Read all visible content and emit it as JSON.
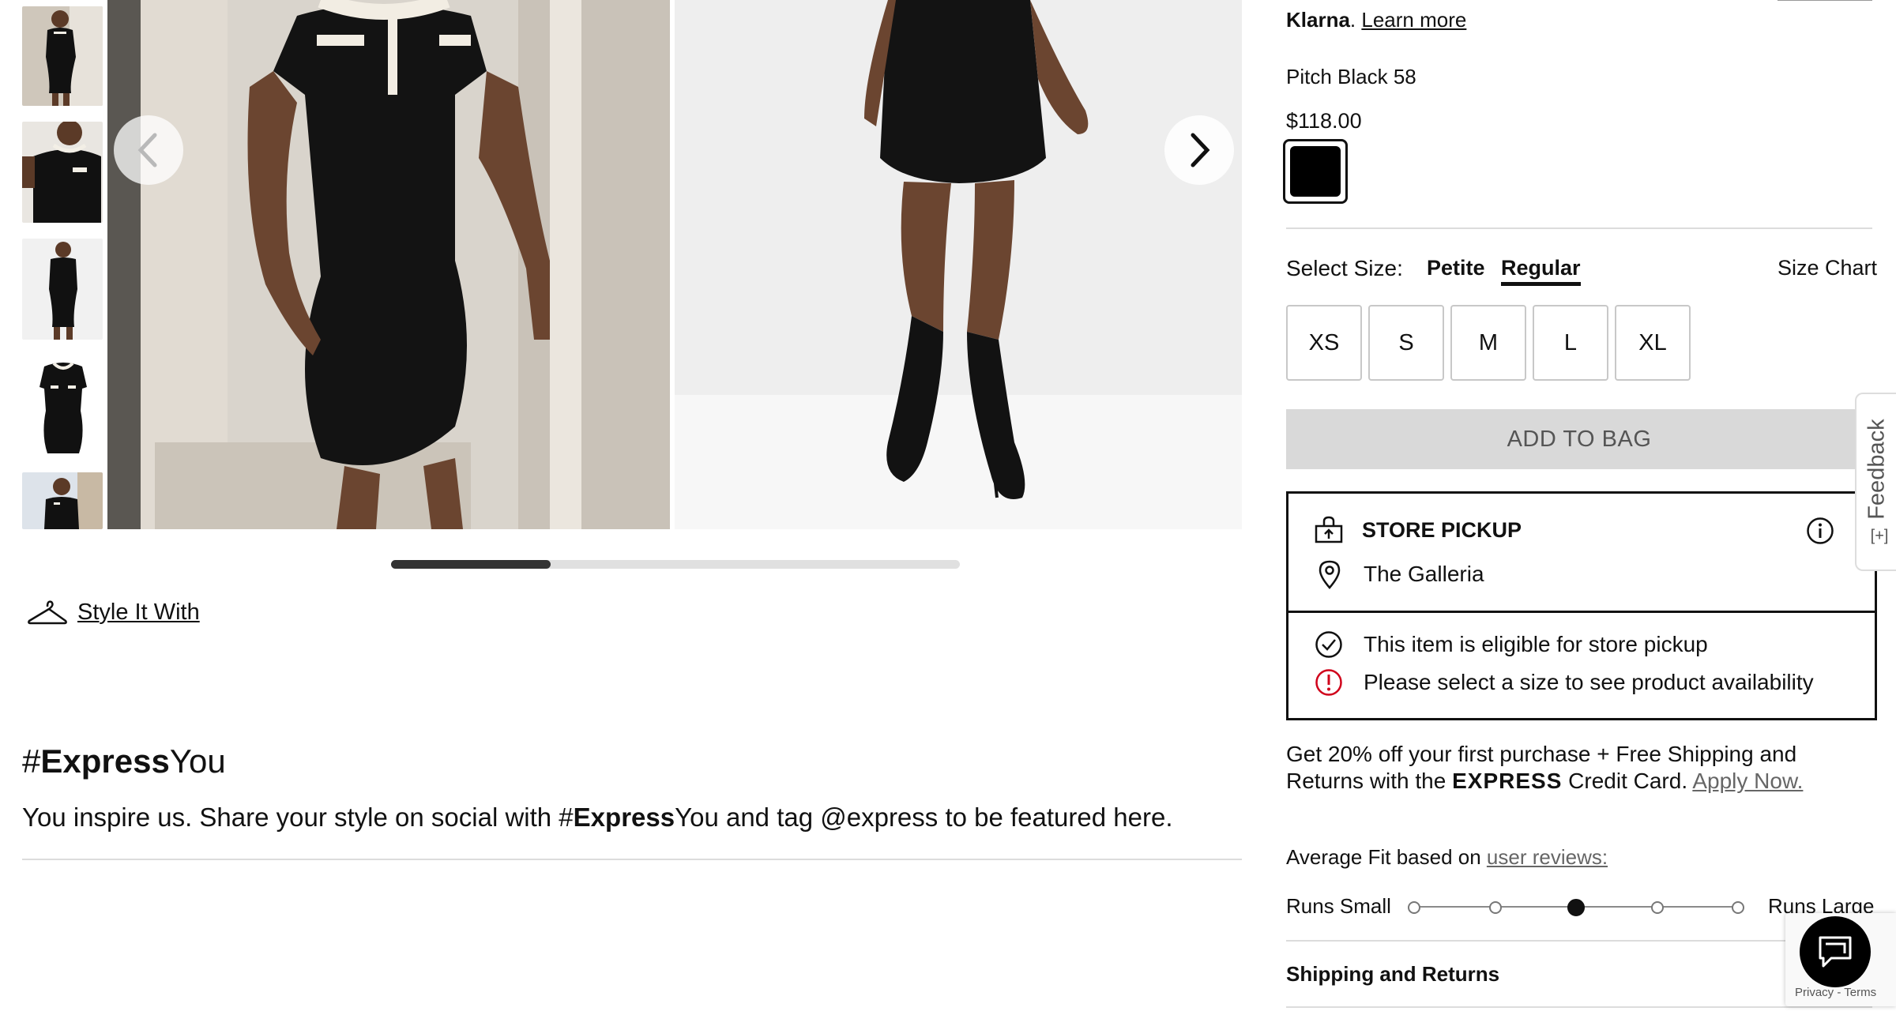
{
  "gallery": {
    "prev_label": "Previous image",
    "next_label": "Next image",
    "scroll_progress": 0.28
  },
  "style_it_with": {
    "label": "Style It With",
    "icon": "hanger-icon"
  },
  "express_you": {
    "title_hash": "#",
    "title_bold": "Express",
    "title_rest": "You",
    "text_before": "You inspire us. Share your style on social with #",
    "text_bold": "Express",
    "text_after": "You and tag @express to be featured here."
  },
  "product": {
    "klarna_brand": "Klarna",
    "klarna_link": "Learn more",
    "color_name": "Pitch Black 58",
    "price": "$118.00",
    "swatch_color": "#000000"
  },
  "size": {
    "label": "Select Size:",
    "tabs": [
      {
        "label": "Petite",
        "selected": false
      },
      {
        "label": "Regular",
        "selected": true
      }
    ],
    "chart_label": "Size Chart",
    "options": [
      "XS",
      "S",
      "M",
      "L",
      "XL"
    ]
  },
  "add_to_bag": "ADD TO BAG",
  "store_pickup": {
    "title": "STORE PICKUP",
    "store": "The Galleria",
    "eligible": "This item is eligible for store pickup",
    "warning": "Please select a size to see product availability",
    "warning_color": "#d0021b"
  },
  "credit_card": {
    "line1": "Get 20% off your first purchase + Free Shipping and",
    "line2_before": "Returns with the ",
    "brand": "EXPRESS",
    "line2_after": " Credit Card. ",
    "apply_link": "Apply Now."
  },
  "fit": {
    "label": "Average Fit based on ",
    "link": "user reviews:",
    "min_label": "Runs Small",
    "max_label": "Runs Large",
    "positions": 5,
    "selected_index": 2
  },
  "shipping_label": "Shipping and Returns",
  "feedback_label": "Feedback",
  "recaptcha": {
    "privacy": "Privacy",
    "sep": " - ",
    "terms": "Terms"
  }
}
